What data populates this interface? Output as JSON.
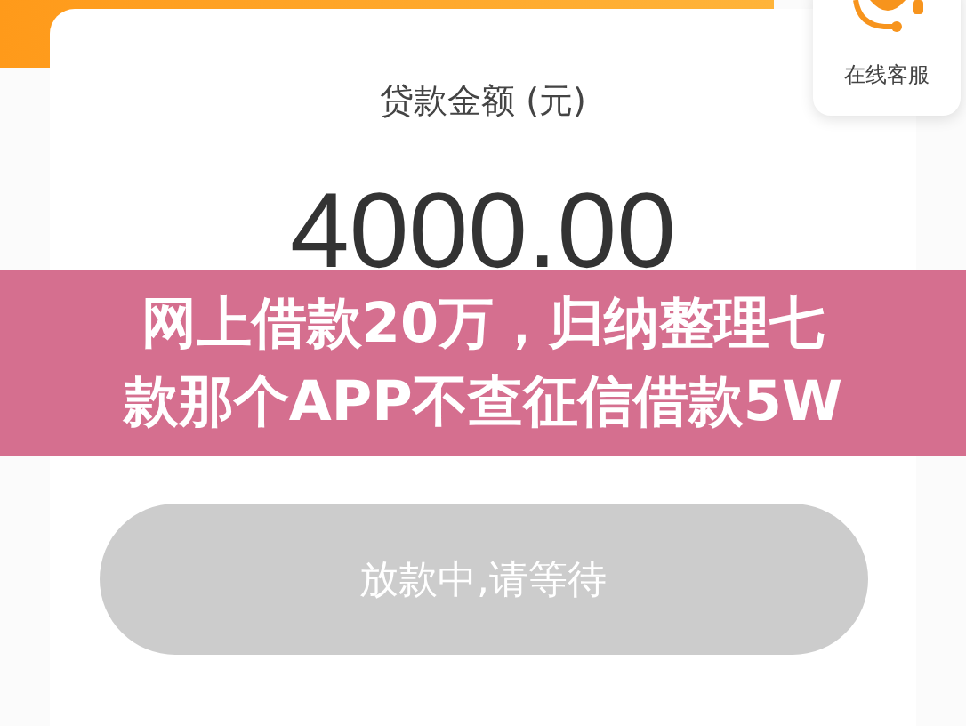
{
  "service": {
    "label": "在线客服"
  },
  "loan": {
    "label": "贷款金额 (元)",
    "amount": "4000.00"
  },
  "button": {
    "label": "放款中,请等待",
    "disabled": true
  },
  "caption": {
    "lines": [
      "网上借款20万，归纳整理七",
      "款那个APP不查征信借款5W"
    ]
  }
}
